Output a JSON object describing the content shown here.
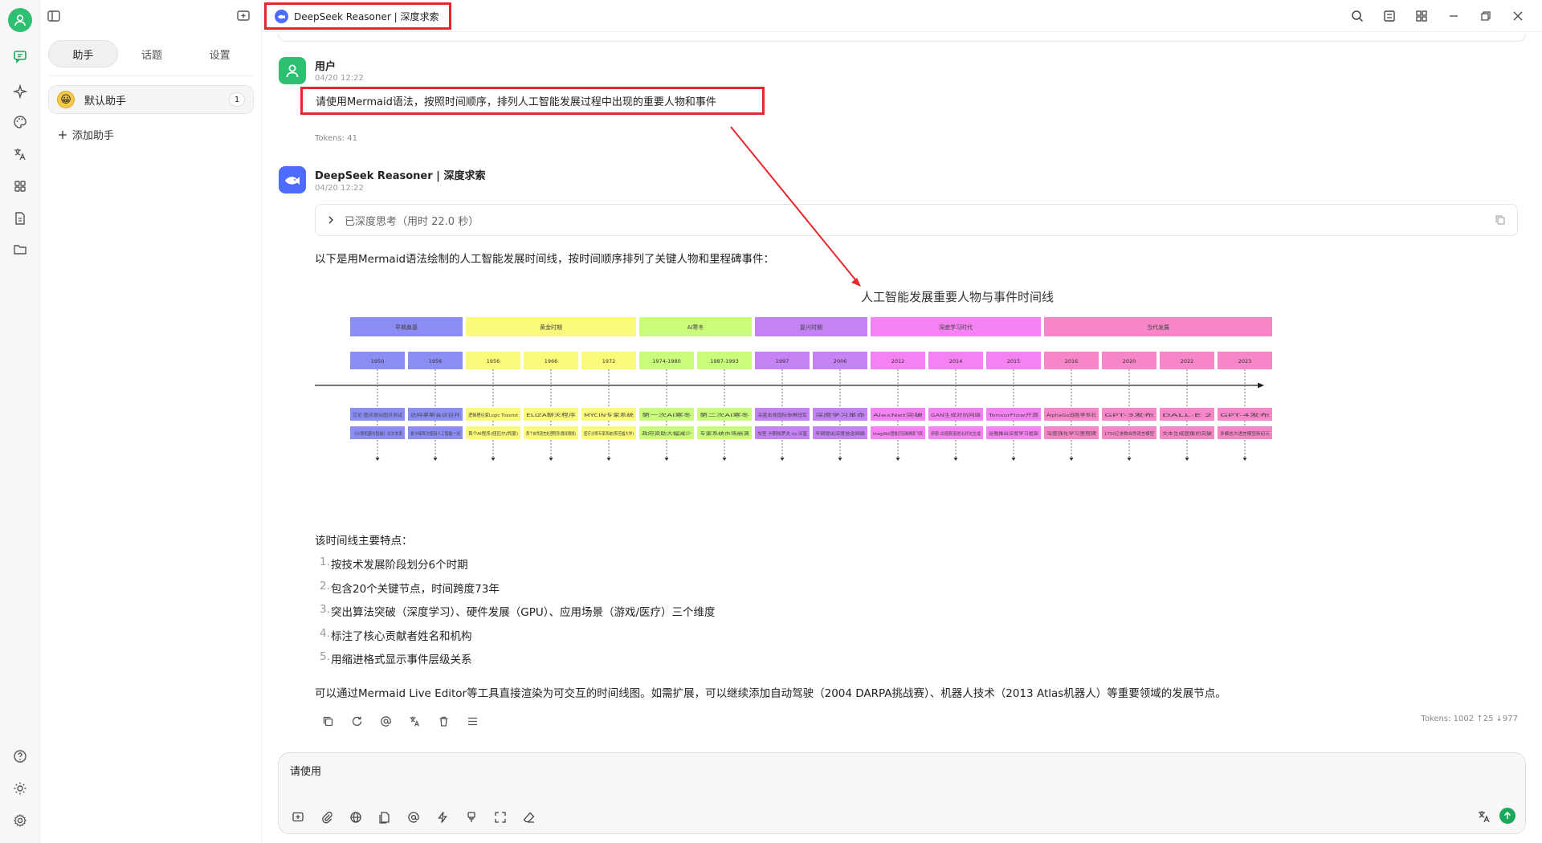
{
  "window": {
    "model_title": "DeepSeek Reasoner | 深度求索"
  },
  "panel": {
    "tabs": [
      {
        "label": "助手"
      },
      {
        "label": "话题"
      },
      {
        "label": "设置"
      }
    ],
    "assistant": {
      "emoji": "😀",
      "name": "默认助手",
      "count": "1"
    },
    "add_label": "添加助手"
  },
  "user_msg": {
    "name": "用户",
    "time": "04/20 12:22",
    "text": "请使用Mermaid语法，按照时间顺序，排列人工智能发展过程中出现的重要人物和事件",
    "tokens": "Tokens: 41"
  },
  "ai_msg": {
    "name": "DeepSeek Reasoner | 深度求索",
    "time": "04/20 12:22",
    "thinking": "已深度思考（用时 22.0 秒）",
    "intro": "以下是用Mermaid语法绘制的人工智能发展时间线，按时间顺序排列了关键人物和里程碑事件：",
    "features_title": "该时间线主要特点：",
    "features": [
      {
        "n": "1.",
        "text": "按技术发展阶段划分6个时期"
      },
      {
        "n": "2.",
        "text": "包含20个关键节点，时间跨度73年"
      },
      {
        "n": "3.",
        "text": "突出算法突破（深度学习）、硬件发展（GPU）、应用场景（游戏/医疗）三个维度"
      },
      {
        "n": "4.",
        "text": "标注了核心贡献者姓名和机构"
      },
      {
        "n": "5.",
        "text": "用缩进格式显示事件层级关系"
      }
    ],
    "closing": "可以通过Mermaid Live Editor等工具直接渲染为可交互的时间线图。如需扩展，可以继续添加自动驾驶（2004 DARPA挑战赛）、机器人技术（2013 Atlas机器人）等重要领域的发展节点。",
    "tokens": "Tokens: 1002 ↑25 ↓977"
  },
  "input": {
    "value": "请使用"
  },
  "diagram": {
    "title": "人工智能发展重要人物与事件时间线",
    "sections": [
      {
        "label": "早期奠基",
        "color": "#8c8cf5",
        "span": 2
      },
      {
        "label": "黄金时期",
        "color": "#fbfb7a",
        "span": 3
      },
      {
        "label": "AI寒冬",
        "color": "#cafb7a",
        "span": 2
      },
      {
        "label": "复兴时期",
        "color": "#c482f5",
        "span": 2
      },
      {
        "label": "深度学习时代",
        "color": "#f582f2",
        "span": 3
      },
      {
        "label": "当代发展",
        "color": "#f786c8",
        "span": 4
      }
    ],
    "columns": [
      {
        "year": "1950",
        "e1": "艾伦·图灵提出图灵测试",
        "e2": "《计算机器与智能》论文发表"
      },
      {
        "year": "1956",
        "e1": "达特茅斯会议召开",
        "e2": "麦卡锡首次使用人工智能一词"
      },
      {
        "year": "1956",
        "e1": "逻辑理论家Logic Theorist",
        "e2": "首个AI程序(纽厄尔/西蒙)"
      },
      {
        "year": "1966",
        "e1": "ELIZA聊天程序",
        "e2": "首个自然语言处理程序(魏泽鲍姆)"
      },
      {
        "year": "1972",
        "e1": "MYCIN专家系统",
        "e2": "医疗诊断专家系统(斯坦福大学)"
      },
      {
        "year": "1974-1980",
        "e1": "第一次AI寒冬",
        "e2": "政府资助大幅减少"
      },
      {
        "year": "1987-1993",
        "e1": "第二次AI寒冬",
        "e2": "专家系统市场崩溃"
      },
      {
        "year": "1997",
        "e1": "深蓝击败国际象棋冠军",
        "e2": "加里·卡斯帕罗夫 vs 深蓝"
      },
      {
        "year": "2006",
        "e1": "深度学习革命",
        "e2": "辛顿提出深度信念网络"
      },
      {
        "year": "2012",
        "e1": "AlexNet突破",
        "e2": "ImageNet图像识别准确率飞跃"
      },
      {
        "year": "2014",
        "e1": "GAN生成对抗网络",
        "e2": "伊恩·古德费洛提出对抗生成"
      },
      {
        "year": "2015",
        "e1": "TensorFlow开源",
        "e2": "谷歌推出深度学习框架"
      },
      {
        "year": "2016",
        "e1": "AlphaGo战胜李世石",
        "e2": "深度强化学习里程碑"
      },
      {
        "year": "2020",
        "e1": "GPT-3发布",
        "e2": "1750亿参数自然语言模型"
      },
      {
        "year": "2022",
        "e1": "DALL·E 2",
        "e2": "文本生成图像的突破"
      },
      {
        "year": "2023",
        "e1": "GPT-4发布",
        "e2": "多模态大语言模型新纪元"
      }
    ]
  }
}
